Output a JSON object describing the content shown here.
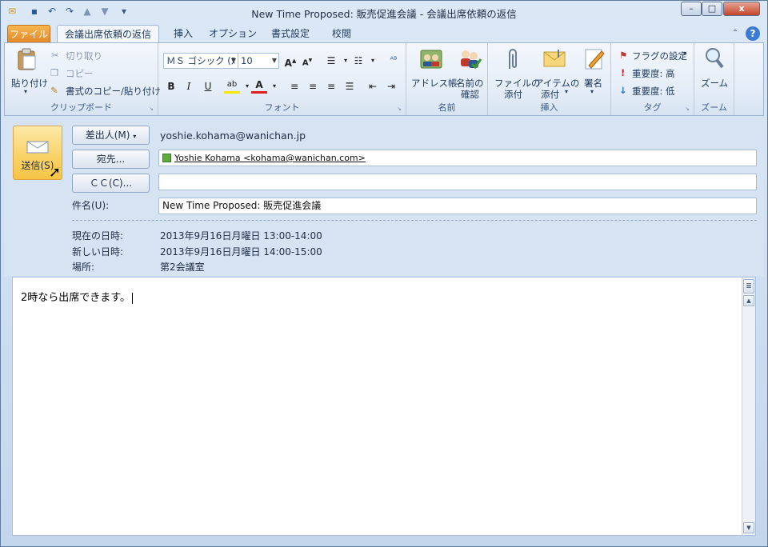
{
  "window": {
    "title": "New Time Proposed: 販売促進会議 - 会議出席依頼の返信",
    "minimize": "–",
    "maximize": "□",
    "close": "x"
  },
  "tabs": {
    "file": "ファイル",
    "active": "会議出席依頼の返信",
    "insert": "挿入",
    "options": "オプション",
    "format": "書式設定",
    "review": "校閲"
  },
  "ribbon": {
    "clipboard": {
      "paste": "貼り付け",
      "cut": "切り取り",
      "copy": "コピー",
      "format_painter": "書式のコピー/貼り付け",
      "label": "クリップボード"
    },
    "font": {
      "font_name": "ＭＳ ゴシック (ﾇ",
      "font_size": "10",
      "label": "フォント"
    },
    "names": {
      "address_book": "アドレス帳",
      "check_names_1": "名前の",
      "check_names_2": "確認",
      "label": "名前"
    },
    "insert": {
      "attach_file_1": "ファイルの",
      "attach_file_2": "添付",
      "attach_item_1": "アイテムの",
      "attach_item_2": "添付",
      "signature": "署名",
      "label": "挿入"
    },
    "tags": {
      "follow_up": "フラグの設定",
      "high": "重要度: 高",
      "low": "重要度: 低",
      "label": "タグ"
    },
    "zoom": {
      "zoom": "ズーム",
      "label": "ズーム"
    }
  },
  "header": {
    "send": "送信(S)",
    "from_button": "差出人(M)",
    "from_value": "yoshie.kohama@wanichan.jp",
    "to_button": "宛先...",
    "to_value": "Yoshie Kohama <kohama@wanichan.com>",
    "cc_button": "ＣＣ(C)...",
    "cc_value": "",
    "subject_label": "件名(U):",
    "subject_value": "New Time Proposed: 販売促進会議",
    "current_label": "現在の日時:",
    "current_value": "2013年9月16日月曜日 13:00-14:00",
    "new_label": "新しい日時:",
    "new_value": "2013年9月16日月曜日 14:00-15:00",
    "location_label": "場所:",
    "location_value": "第2会議室"
  },
  "body": {
    "text": "2時なら出席できます。"
  },
  "colors": {
    "accent_file": "#e4862a",
    "send_button": "#f9d36a",
    "ribbon_bg": "#e3ecf7"
  }
}
